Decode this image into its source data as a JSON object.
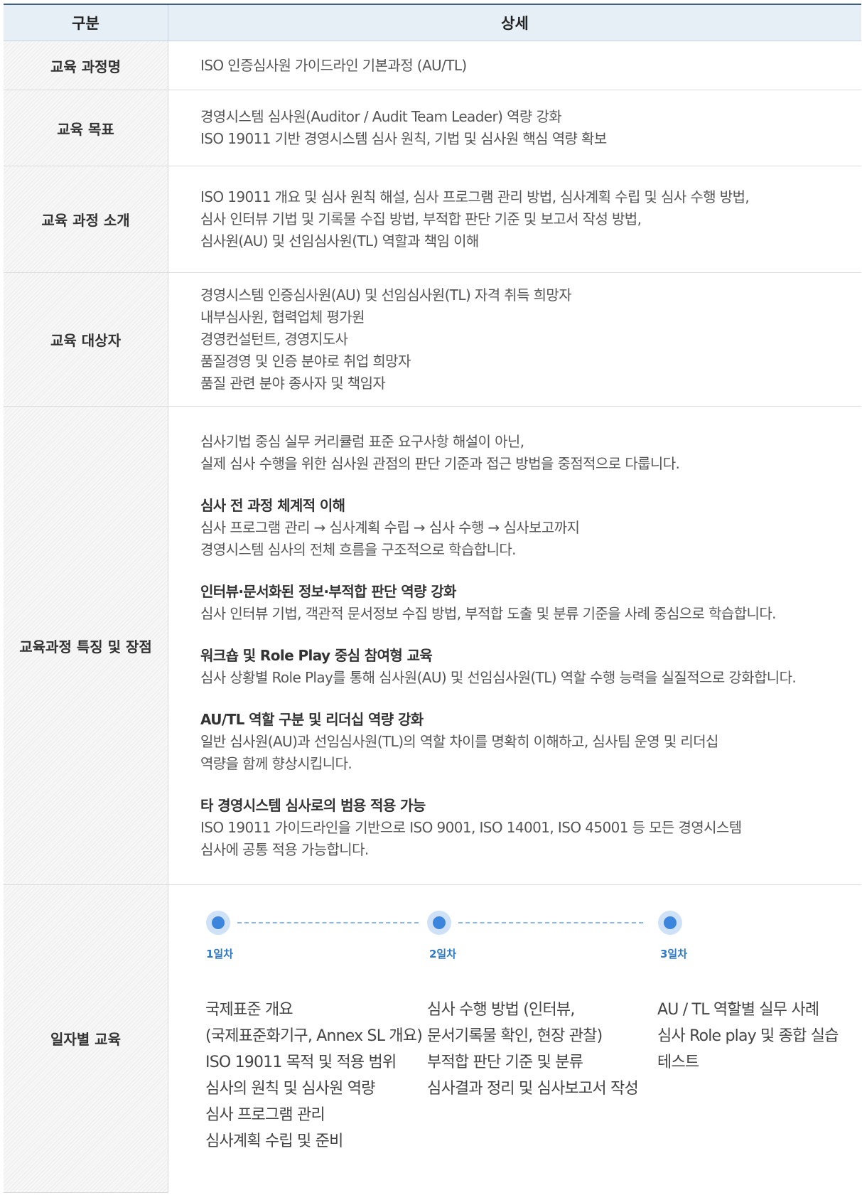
{
  "header": {
    "col1": "구분",
    "col2": "상세"
  },
  "rows": {
    "course_name": {
      "label": "교육 과정명",
      "lines": [
        "ISO 인증심사원 가이드라인 기본과정 (AU/TL)"
      ]
    },
    "goal": {
      "label": "교육 목표",
      "lines": [
        "경영시스템 심사원(Auditor / Audit Team Leader) 역량 강화",
        "ISO 19011 기반 경영시스템 심사 원칙, 기법 및 심사원 핵심 역량 확보"
      ]
    },
    "intro": {
      "label": "교육 과정 소개",
      "lines": [
        "ISO 19011 개요 및 심사 원칙 해설, 심사 프로그램 관리 방법, 심사계획 수립 및 심사 수행 방법,",
        "심사 인터뷰 기법 및 기록물 수집 방법, 부적합 판단 기준 및 보고서 작성 방법,",
        "심사원(AU) 및 선임심사원(TL) 역할과 책임 이해"
      ]
    },
    "target": {
      "label": "교육 대상자",
      "lines": [
        "경영시스템 인증심사원(AU) 및 선임심사원(TL) 자격 취득 희망자",
        "내부심사원, 협력업체 평가원",
        "경영컨설턴트, 경영지도사",
        "품질경영 및 인증 분야로 취업 희망자",
        "품질 관련 분야 종사자 및 책임자"
      ]
    },
    "features": {
      "label": "교육과정 특징 및 장점",
      "intro": [
        "심사기법 중심 실무 커리큘럼 표준 요구사항 해설이 아닌,",
        "실제 심사 수행을 위한 심사원 관점의 판단 기준과 접근 방법을 중점적으로 다룹니다."
      ],
      "sections": [
        {
          "title": "심사 전 과정 체계적 이해",
          "lines": [
            "심사 프로그램 관리 → 심사계획 수립 → 심사 수행 → 심사보고까지",
            "경영시스템 심사의 전체 흐름을 구조적으로 학습합니다."
          ]
        },
        {
          "title": "인터뷰·문서화된 정보·부적합 판단 역량 강화",
          "lines": [
            "심사 인터뷰 기법, 객관적 문서정보 수집 방법, 부적합 도출 및 분류 기준을 사례 중심으로 학습합니다."
          ]
        },
        {
          "title": "워크숍 및 Role Play 중심 참여형 교육",
          "lines": [
            "심사 상황별 Role Play를 통해 심사원(AU) 및 선임심사원(TL) 역할 수행 능력을 실질적으로 강화합니다."
          ]
        },
        {
          "title": "AU/TL 역할 구분 및 리더십 역량 강화",
          "lines": [
            "일반 심사원(AU)과 선임심사원(TL)의 역할 차이를 명확히 이해하고, 심사팀 운영 및 리더십",
            "역량을 함께 향상시킵니다."
          ]
        },
        {
          "title": "타 경영시스템 심사로의 범용 적용 가능",
          "lines": [
            "ISO 19011 가이드라인을 기반으로 ISO 9001, ISO 14001, ISO 45001 등 모든 경영시스템",
            "심사에 공통 적용 가능합니다."
          ]
        }
      ]
    },
    "schedule": {
      "label": "일자별 교육",
      "days": [
        {
          "day": "1일차",
          "items": [
            "국제표준 개요",
            "(국제표준화기구, Annex SL 개요)",
            "ISO 19011 목적 및 적용 범위",
            "심사의 원칙 및 심사원 역량",
            "심사 프로그램 관리",
            "심사계획 수립 및 준비"
          ]
        },
        {
          "day": "2일차",
          "items": [
            "심사 수행 방법 (인터뷰,",
            "문서기록물 확인, 현장 관찰)",
            "부적합 판단 기준 및 분류",
            "심사결과 정리 및 심사보고서 작성"
          ]
        },
        {
          "day": "3일차",
          "items": [
            "AU / TL 역할별 실무 사례",
            "심사 Role play 및 종합 실습",
            "테스트"
          ]
        }
      ]
    }
  }
}
